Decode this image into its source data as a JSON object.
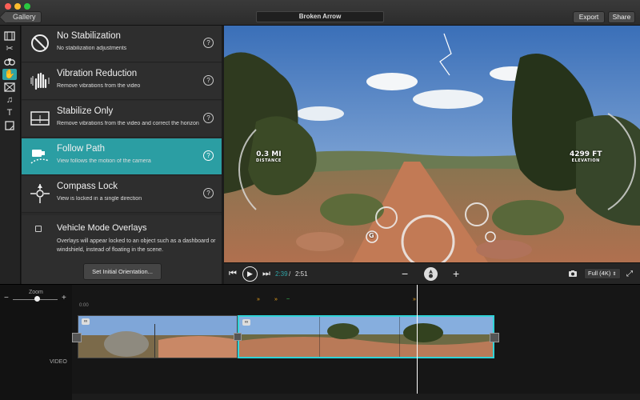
{
  "titlebar": {
    "gallery_label": "Gallery",
    "document_title": "Broken Arrow",
    "export_label": "Export",
    "share_label": "Share"
  },
  "toolstrip": {
    "tools": [
      "film-icon",
      "scissors-icon",
      "binoculars-icon",
      "hand-icon",
      "transition-icon",
      "music-icon",
      "text-icon",
      "sticker-icon"
    ],
    "active_tool": "hand-icon"
  },
  "stabilization": {
    "options": [
      {
        "title": "No Stabilization",
        "description": "No stabilization adjustments",
        "icon": "no-symbol-icon",
        "active": false
      },
      {
        "title": "Vibration Reduction",
        "description": "Remove vibrations from the video",
        "icon": "vibrating-hand-icon",
        "active": false
      },
      {
        "title": "Stabilize Only",
        "description": "Remove vibrations from the video and correct the horizon",
        "icon": "horizon-icon",
        "active": false
      },
      {
        "title": "Follow Path",
        "description": "View follows the motion of the camera",
        "icon": "camera-path-icon",
        "active": true
      },
      {
        "title": "Compass Lock",
        "description": "View is locked in a single direction",
        "icon": "compass-icon",
        "active": false
      }
    ],
    "help_glyph": "?",
    "overlay_title": "Vehicle Mode Overlays",
    "overlay_description": "Overlays will appear locked to an object such as a dashboard or windshield, instead of floating in the scene.",
    "overlay_checked": false,
    "orientation_button": "Set Initial Orientation..."
  },
  "preview": {
    "distance_value": "0.3 MI",
    "distance_label": "DISTANCE",
    "elevation_value": "4299 FT",
    "elevation_label": "ELEVATION",
    "gauge_left": "G"
  },
  "player": {
    "current_time": "2:39",
    "separator": "/",
    "total_time": "2:51",
    "resolution": "Full (4K)"
  },
  "timeline": {
    "zoom_label": "Zoom",
    "zoom_minus": "−",
    "zoom_plus": "+",
    "ruler_start": "0:00",
    "track_label": "VIDEO",
    "zoom_level": 0.55
  },
  "colors": {
    "accent": "#2fa3a6",
    "selection": "#2fd3d8",
    "marker": "#f4a81d"
  }
}
